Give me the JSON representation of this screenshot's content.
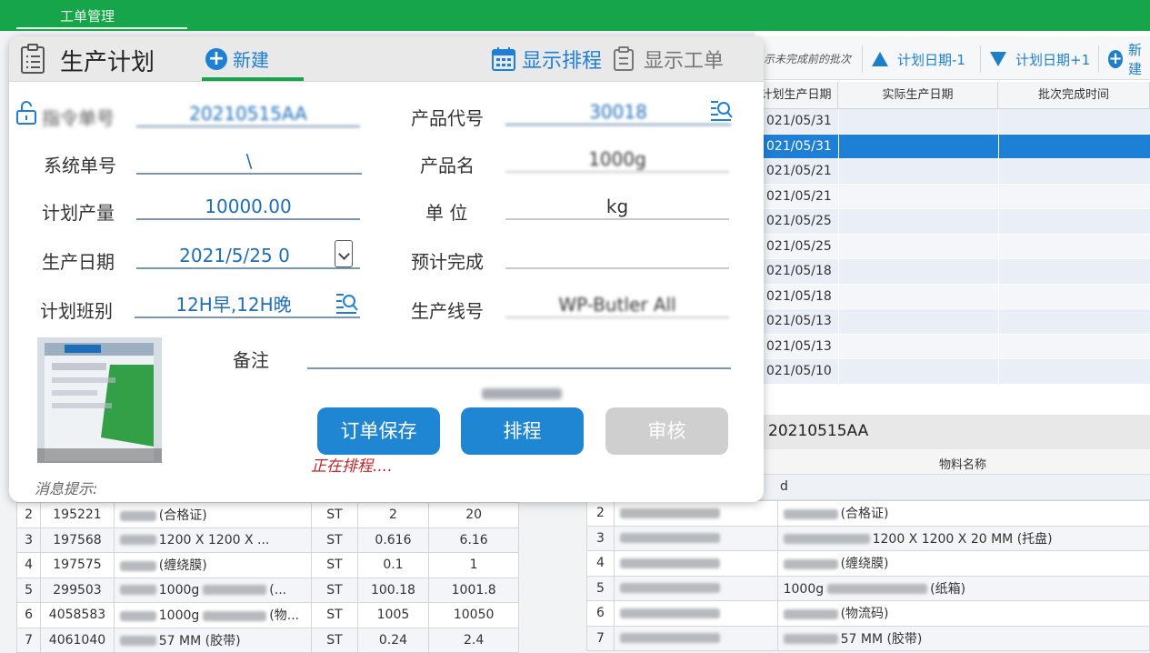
{
  "topbar": {
    "tab_label": "工单管理"
  },
  "bg_toolbar": {
    "cut_label": "示未完成前的批次",
    "prev_label": "计划日期-1",
    "next_label": "计划日期+1",
    "new_label": "新建"
  },
  "bg_grid": {
    "headers": [
      "计划生产日期",
      "实际生产日期",
      "批次完成时间"
    ],
    "rows": [
      "021/05/31",
      "021/05/31",
      "021/05/21",
      "021/05/21",
      "021/05/25",
      "021/05/25",
      "021/05/18",
      "021/05/18",
      "021/05/13",
      "021/05/13",
      "021/05/10"
    ],
    "selected_index": 1
  },
  "bg_section": {
    "order_no": "20210515AA"
  },
  "right_lower": {
    "header": "物料名称",
    "first_row": "d",
    "rows": [
      {
        "n": "2",
        "name": "(合格证)"
      },
      {
        "n": "3",
        "name": "1200 X 1200 X 20 MM (托盘)"
      },
      {
        "n": "4",
        "name": "(缠绕膜)"
      },
      {
        "n": "5",
        "name": "1000g",
        "suffix": "(纸箱)"
      },
      {
        "n": "6",
        "name": "(物流码)"
      },
      {
        "n": "7",
        "name": "57 MM (胶带)"
      }
    ]
  },
  "left_lower": {
    "rows": [
      {
        "n": "2",
        "code": "195221",
        "name": "(合格证)",
        "unit": "ST",
        "a": "2",
        "b": "20"
      },
      {
        "n": "3",
        "code": "197568",
        "name": "1200 X 1200 X ...",
        "unit": "ST",
        "a": "0.616",
        "b": "6.16"
      },
      {
        "n": "4",
        "code": "197575",
        "name": "(缠绕膜)",
        "unit": "ST",
        "a": "0.1",
        "b": "1"
      },
      {
        "n": "5",
        "code": "299503",
        "name": "1000g",
        "name_suffix": "(...",
        "unit": "ST",
        "a": "100.18",
        "b": "1001.8"
      },
      {
        "n": "6",
        "code": "4058583",
        "name": "1000g",
        "name_suffix": "(物...",
        "unit": "ST",
        "a": "1005",
        "b": "10050"
      },
      {
        "n": "7",
        "code": "4061040",
        "name": "57 MM (胶带)",
        "unit": "ST",
        "a": "0.24",
        "b": "2.4"
      }
    ]
  },
  "dialog": {
    "title": "生产计划",
    "new_label": "新建",
    "schedule_label": "显示排程",
    "order_label": "显示工单",
    "fields": {
      "order_no_label": "指令单号",
      "order_no_value": "20210515AA",
      "system_no_label": "系统单号",
      "system_no_value": "\\",
      "plan_qty_label": "计划产量",
      "plan_qty_value": "10000.00",
      "prod_date_label": "生产日期",
      "prod_date_value": "2021/5/25 0",
      "shift_label": "计划班别",
      "shift_value": "12H早,12H晚",
      "product_code_label": "产品代号",
      "product_code_value": "30018",
      "product_name_label": "产品名",
      "product_name_value": "1000g",
      "unit_label": "单 位",
      "unit_value": "kg",
      "expected_label": "预计完成",
      "expected_value": "",
      "line_label": "生产线号",
      "line_value": "WP-Butler All",
      "remark_label": "备注",
      "remark_value": ""
    },
    "buttons": {
      "save": "订单保存",
      "schedule": "排程",
      "approve": "审核"
    },
    "status_text": "正在排程....",
    "message_label": "消息提示:"
  },
  "colors": {
    "brand_green": "#16a54a",
    "accent_blue": "#1f86d4",
    "selected_row": "#1e7fd6",
    "error_red": "#c0262d"
  }
}
